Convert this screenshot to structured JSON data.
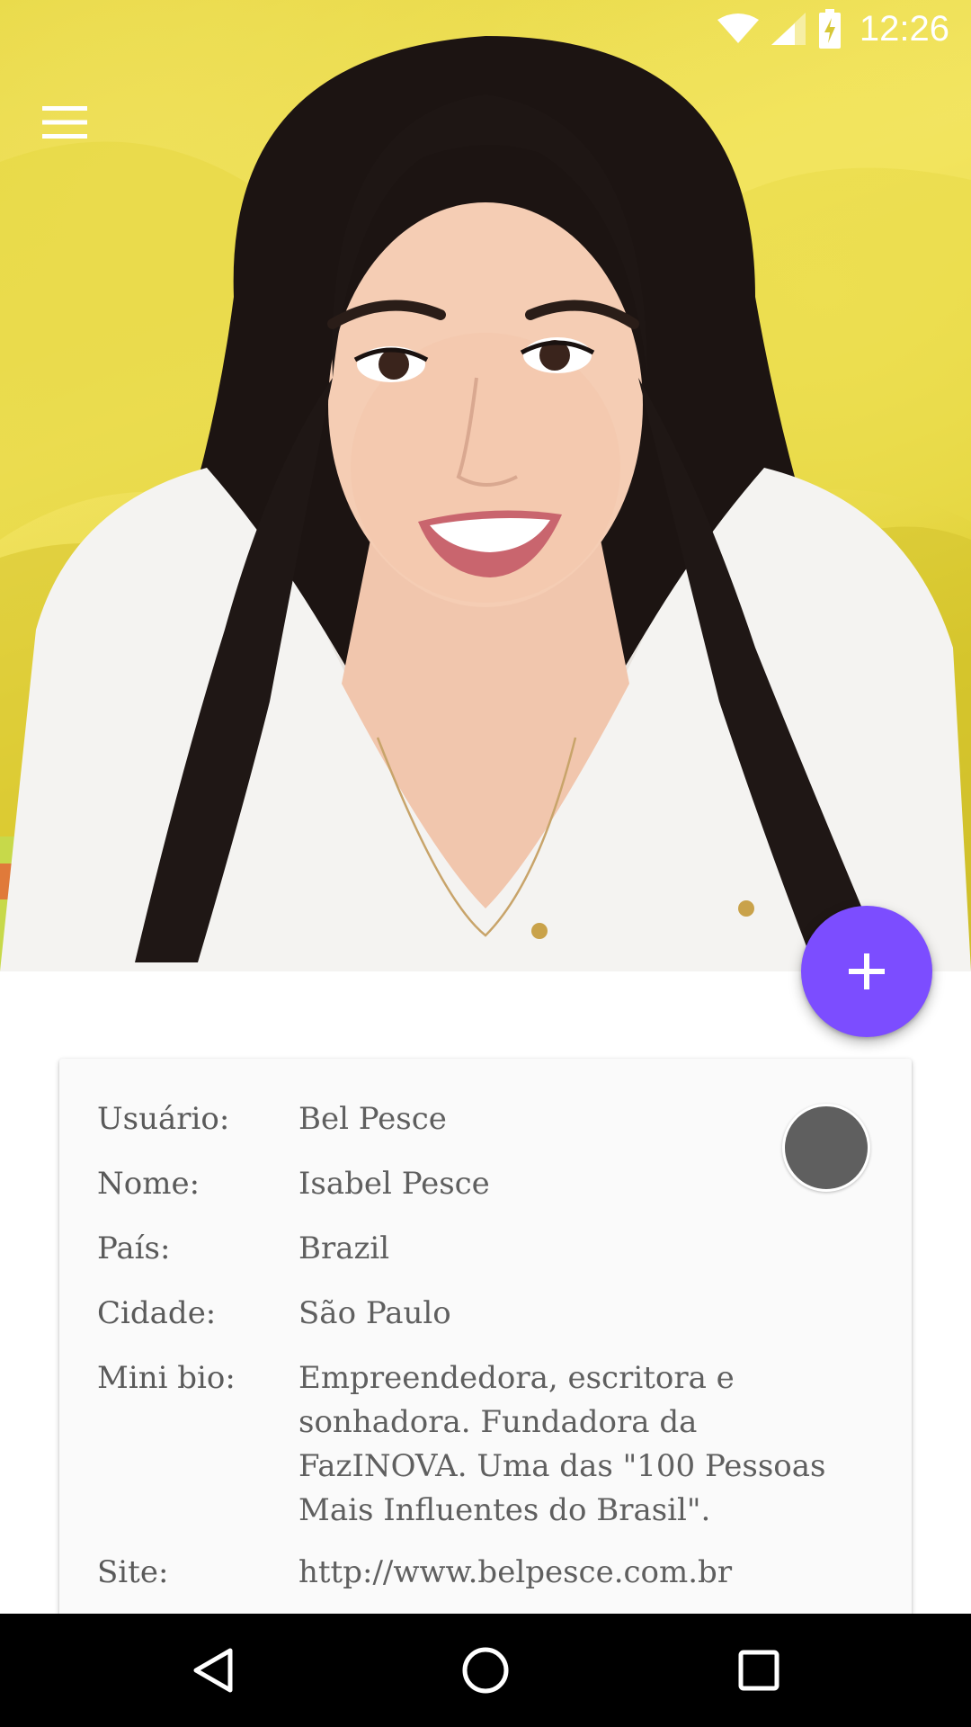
{
  "status_bar": {
    "time": "12:26",
    "icons": [
      "wifi-icon",
      "cell-signal-icon",
      "battery-charging-icon"
    ]
  },
  "header": {
    "menu_icon": "hamburger-menu-icon",
    "photo": "profile-cover-photo"
  },
  "fab": {
    "icon": "plus-icon",
    "color": "#7c4dff"
  },
  "profile": {
    "avatar_color": "#5f5f5f",
    "fields": [
      {
        "label": "Usuário:",
        "value": "Bel Pesce"
      },
      {
        "label": "Nome:",
        "value": "Isabel Pesce"
      },
      {
        "label": "País:",
        "value": "Brazil"
      },
      {
        "label": "Cidade:",
        "value": "São Paulo"
      },
      {
        "label": "Mini bio:",
        "value": "Empreendedora, escritora e sonhadora. Fundadora da FazINOVA. Uma das \"100 Pessoas Mais Influentes do Brasil\"."
      },
      {
        "label": "Site:",
        "value": "http://www.belpesce.com.br"
      }
    ]
  },
  "nav_bar": {
    "buttons": [
      "back-icon",
      "home-icon",
      "recents-icon"
    ]
  }
}
